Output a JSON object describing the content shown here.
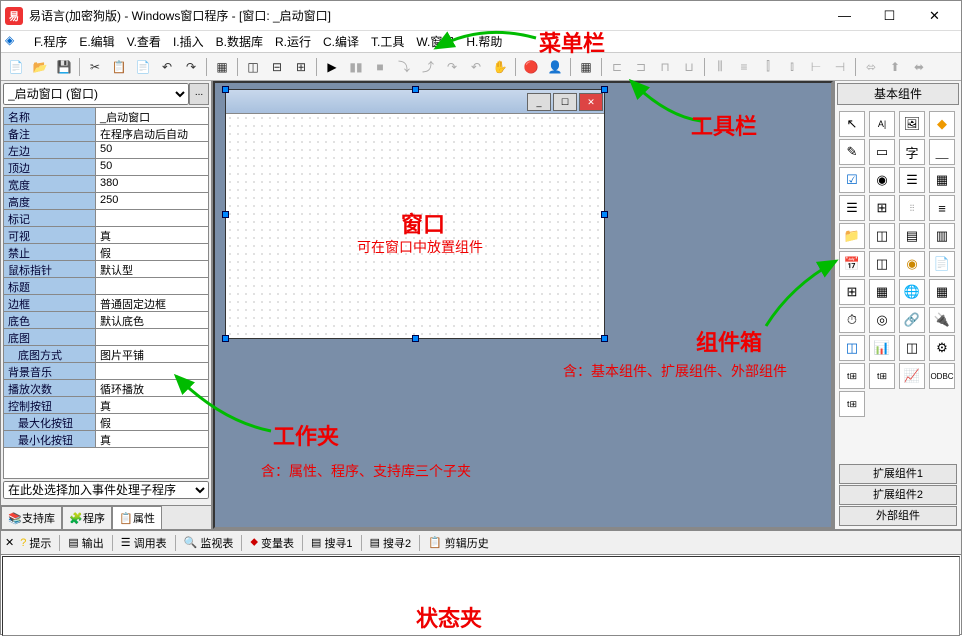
{
  "title": "易语言(加密狗版) - Windows窗口程序 - [窗口: _启动窗口]",
  "menus": [
    "F.程序",
    "E.编辑",
    "V.查看",
    "I.插入",
    "B.数据库",
    "R.运行",
    "C.编译",
    "T.工具",
    "W.窗口",
    "H.帮助"
  ],
  "properties": {
    "dropdown": "_启动窗口 (窗口)",
    "rows": [
      {
        "k": "名称",
        "v": "_启动窗口"
      },
      {
        "k": "备注",
        "v": "在程序启动后自动"
      },
      {
        "k": "左边",
        "v": "50"
      },
      {
        "k": "顶边",
        "v": "50"
      },
      {
        "k": "宽度",
        "v": "380"
      },
      {
        "k": "高度",
        "v": "250"
      },
      {
        "k": "标记",
        "v": ""
      },
      {
        "k": "可视",
        "v": "真"
      },
      {
        "k": "禁止",
        "v": "假"
      },
      {
        "k": "鼠标指针",
        "v": "默认型"
      },
      {
        "k": "标题",
        "v": ""
      },
      {
        "k": "边框",
        "v": "普通固定边框"
      },
      {
        "k": "底色",
        "v": "默认底色"
      },
      {
        "k": "底图",
        "v": ""
      },
      {
        "k": "底图方式",
        "v": "图片平铺",
        "indent": true
      },
      {
        "k": "背景音乐",
        "v": ""
      },
      {
        "k": "播放次数",
        "v": "循环播放"
      },
      {
        "k": "控制按钮",
        "v": "真"
      },
      {
        "k": "最大化按钮",
        "v": "假",
        "indent": true
      },
      {
        "k": "最小化按钮",
        "v": "真",
        "indent": true
      }
    ],
    "event_dropdown": "在此处选择加入事件处理子程序"
  },
  "left_tabs": [
    "支持库",
    "程序",
    "属性"
  ],
  "component_box": {
    "title": "基本组件",
    "buttons": [
      "扩展组件1",
      "扩展组件2",
      "外部组件"
    ]
  },
  "bottom_tabs": [
    "提示",
    "输出",
    "调用表",
    "监视表",
    "变量表",
    "搜寻1",
    "搜寻2",
    "剪辑历史"
  ],
  "annotations": {
    "menubar": "菜单栏",
    "toolbar": "工具栏",
    "window": "窗口",
    "window_sub": "可在窗口中放置组件",
    "workfolder": "工作夹",
    "workfolder_sub": "含：属性、程序、支持库三个子夹",
    "compbox": "组件箱",
    "compbox_sub": "含：基本组件、扩展组件、外部组件",
    "status": "状态夹"
  }
}
